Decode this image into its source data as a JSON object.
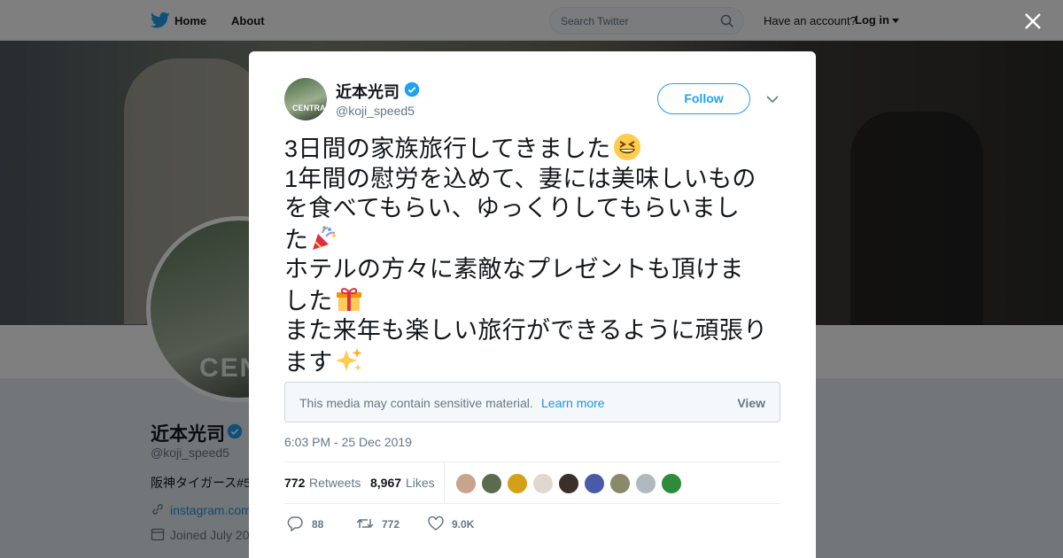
{
  "nav": {
    "home_label": "Home",
    "about_label": "About",
    "search_placeholder": "Search Twitter",
    "account_prompt": "Have an account?",
    "login_label": "Log in"
  },
  "profile": {
    "name": "近本光司",
    "handle": "@koji_speed5",
    "bio": "阪神タイガース#5",
    "link": "instagram.com",
    "joined": "Joined July 20"
  },
  "tweet": {
    "author_name": "近本光司",
    "author_handle": "@koji_speed5",
    "follow_label": "Follow",
    "lines": [
      {
        "text": "3日間の家族旅行してきました",
        "emoji": "grinning-squinting-face"
      },
      {
        "text": "1年間の慰労を込めて、妻には美味しいもの",
        "emoji": ""
      },
      {
        "text": "を食べてもらい、ゆっくりしてもらいまし",
        "emoji": ""
      },
      {
        "text": "た",
        "emoji": "party-popper"
      },
      {
        "text": "ホテルの方々に素敵なプレゼントも頂けま",
        "emoji": ""
      },
      {
        "text": "した",
        "emoji": "wrapped-gift"
      },
      {
        "text": "また来年も楽しい旅行ができるように頑張り",
        "emoji": ""
      },
      {
        "text": "ます",
        "emoji": "sparkles"
      }
    ],
    "sensitive_text": "This media may contain sensitive material.",
    "sensitive_learn_more": "Learn more",
    "sensitive_view": "View",
    "timestamp": "6:03 PM - 25 Dec 2019",
    "retweets_count": "772",
    "retweets_label": "Retweets",
    "likes_count": "8,967",
    "likes_label": "Likes",
    "reply_count": "88",
    "retweet_action_count": "772",
    "like_action_count": "9.0K"
  },
  "colors": {
    "accent": "#1da1f2",
    "link": "#1b95e0",
    "muted": "#657786",
    "text": "#14171a"
  },
  "likers": [
    "#c9a48c",
    "#5a6b4e",
    "#d4a017",
    "#e0d8cc",
    "#3b2f2a",
    "#4a5aa8",
    "#8a8a6a",
    "#b0b8c0",
    "#2e8b3a"
  ]
}
